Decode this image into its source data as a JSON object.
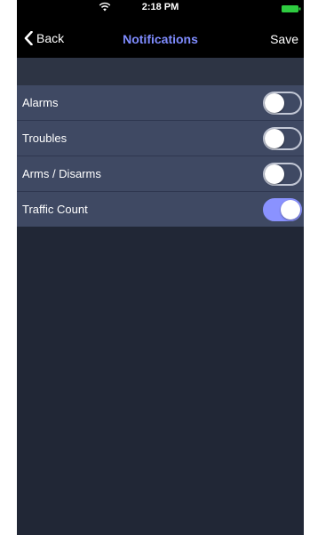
{
  "status_bar": {
    "time": "2:18 PM",
    "wifi_icon": "wifi-icon",
    "battery_icon": "battery-icon",
    "battery_color": "#2ecc40"
  },
  "nav": {
    "back_label": "Back",
    "title": "Notifications",
    "save_label": "Save",
    "title_color": "#7f8cff"
  },
  "settings": [
    {
      "label": "Alarms",
      "enabled": false
    },
    {
      "label": "Troubles",
      "enabled": false
    },
    {
      "label": "Arms / Disarms",
      "enabled": false
    },
    {
      "label": "Traffic Count",
      "enabled": true
    }
  ],
  "colors": {
    "toggle_on": "#8a92ff",
    "background": "#212736",
    "row": "#3f4963"
  }
}
